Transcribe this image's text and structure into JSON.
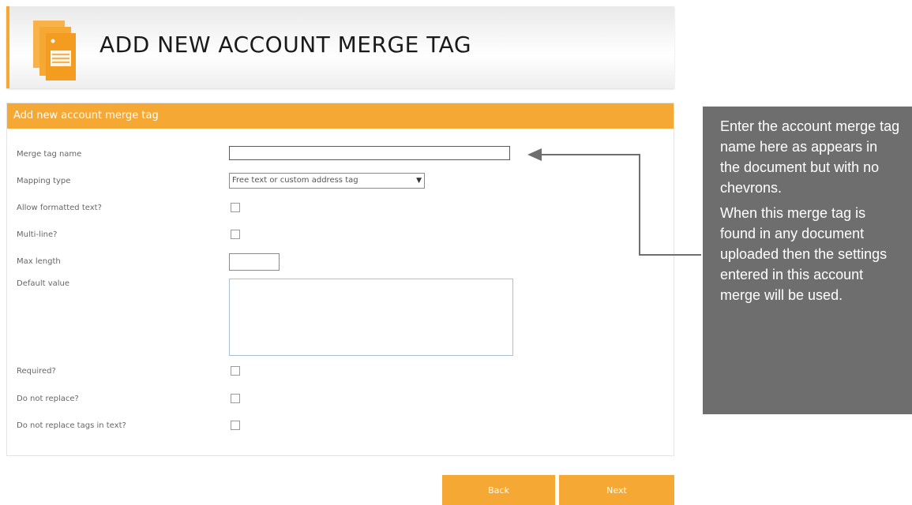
{
  "header": {
    "title": "ADD NEW ACCOUNT MERGE TAG",
    "icon": "document-icon",
    "accent_color": "#f5a833"
  },
  "panel": {
    "title": "Add new account merge tag",
    "fields": {
      "merge_tag_name": {
        "label": "Merge tag name",
        "value": ""
      },
      "mapping_type": {
        "label": "Mapping type",
        "selected": "Free text or custom address tag"
      },
      "allow_formatted_text": {
        "label": "Allow formatted text?",
        "checked": false
      },
      "multi_line": {
        "label": "Multi-line?",
        "checked": false
      },
      "max_length": {
        "label": "Max length",
        "value": ""
      },
      "default_value": {
        "label": "Default value",
        "value": ""
      },
      "required": {
        "label": "Required?",
        "checked": false
      },
      "do_not_replace": {
        "label": "Do not replace?",
        "checked": false
      },
      "do_not_replace_tags_in_text": {
        "label": "Do not replace tags in text?",
        "checked": false
      }
    }
  },
  "buttons": {
    "back_label": "Back",
    "next_label": "Next"
  },
  "callout": {
    "paragraph_1": "Enter the account merge tag name here as appears in the document but with no chevrons.",
    "paragraph_2": "When this merge tag is found in any document uploaded then the settings entered in this account merge will be used.",
    "background_color": "#6e6e6e"
  }
}
